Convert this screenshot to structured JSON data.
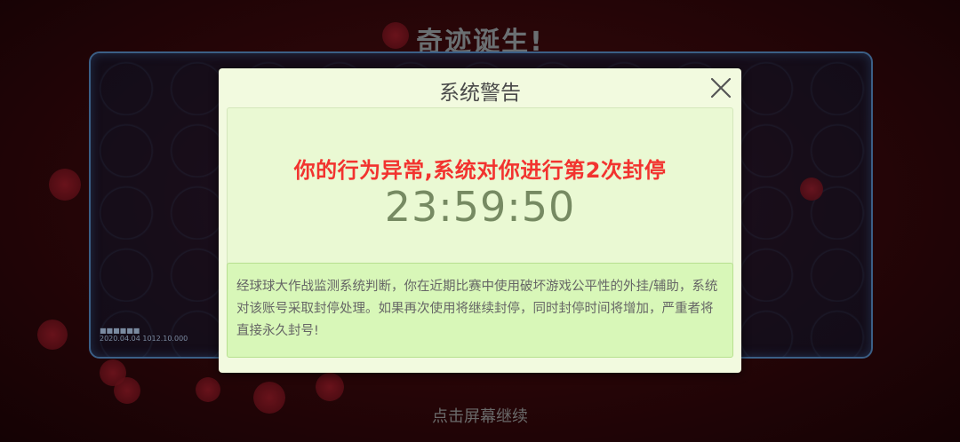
{
  "background": {
    "title": "奇迹诞生!",
    "hint": "点击屏幕继续",
    "stats": [
      "■■■■■■",
      "2020.04.04 1012.10.000"
    ]
  },
  "dialog": {
    "title": "系统警告",
    "close_icon": "close-icon",
    "warning": "你的行为异常,系统对你进行第2次封停",
    "countdown": "23:59:50",
    "description": "经球球大作战监测系统判断，你在近期比赛中使用破坏游戏公平性的外挂/辅助，系统对该账号采取封停处理。如果再次使用将继续封停，同时封停时间将增加，严重者将直接永久封号!"
  },
  "colors": {
    "warning": "#f2332f",
    "countdown": "#768a62",
    "dialog_bg": "#f2fadf",
    "desc_bg": "#d8f7b8"
  }
}
